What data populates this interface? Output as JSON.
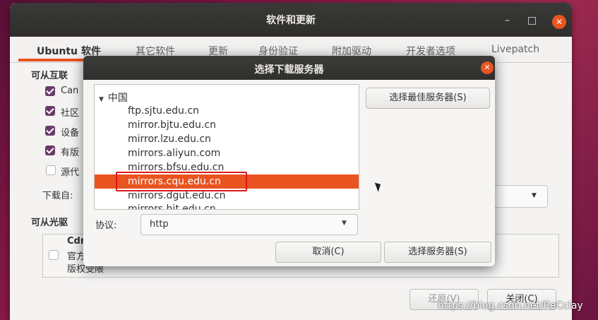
{
  "main_window": {
    "title": "软件和更新",
    "controls": {
      "minimize": "–",
      "maximize": "□",
      "close": "✕"
    },
    "tabs": [
      {
        "label": "Ubuntu 软件",
        "active": true
      },
      {
        "label": "其它软件"
      },
      {
        "label": "更新"
      },
      {
        "label": "身份验证"
      },
      {
        "label": "附加驱动"
      },
      {
        "label": "开发者选项"
      },
      {
        "label": "Livepatch"
      }
    ],
    "internet_section_label": "可从互联",
    "checkboxes": [
      {
        "label": "Can",
        "checked": true
      },
      {
        "label": "社区",
        "checked": true
      },
      {
        "label": "设备",
        "checked": true
      },
      {
        "label": "有版",
        "checked": true
      },
      {
        "label": "源代",
        "checked": false
      }
    ],
    "download_from_label": "下载自:",
    "cdrom_section_label": "可从光驱",
    "cdrom_item": {
      "line1": "Cdr",
      "line2": "官方",
      "line3": "版权受限",
      "checked": false
    },
    "buttons": {
      "revert": "还原(V)",
      "close": "关闭(C)"
    }
  },
  "dialog": {
    "title": "选择下载服务器",
    "close_icon": "✕",
    "group": "中国",
    "servers": [
      "ftp.sjtu.edu.cn",
      "mirror.bjtu.edu.cn",
      "mirror.lzu.edu.cn",
      "mirrors.aliyun.com",
      "mirrors.bfsu.edu.cn",
      "mirrors.cqu.edu.cn",
      "mirrors.dgut.edu.cn",
      "mirrors.hit.edu.cn"
    ],
    "selected_server": "mirrors.cqu.edu.cn",
    "best_server_button": "选择最佳服务器(S)",
    "protocol_label": "协议:",
    "protocol_value": "http",
    "cancel_button": "取消(C)",
    "choose_button": "选择服务器(S)"
  },
  "watermark": "https://blog.csdn.net/ReCclay",
  "colors": {
    "accent": "#e95420",
    "highlight_outline": "#e0161c",
    "checkbox": "#6b3a6b"
  }
}
